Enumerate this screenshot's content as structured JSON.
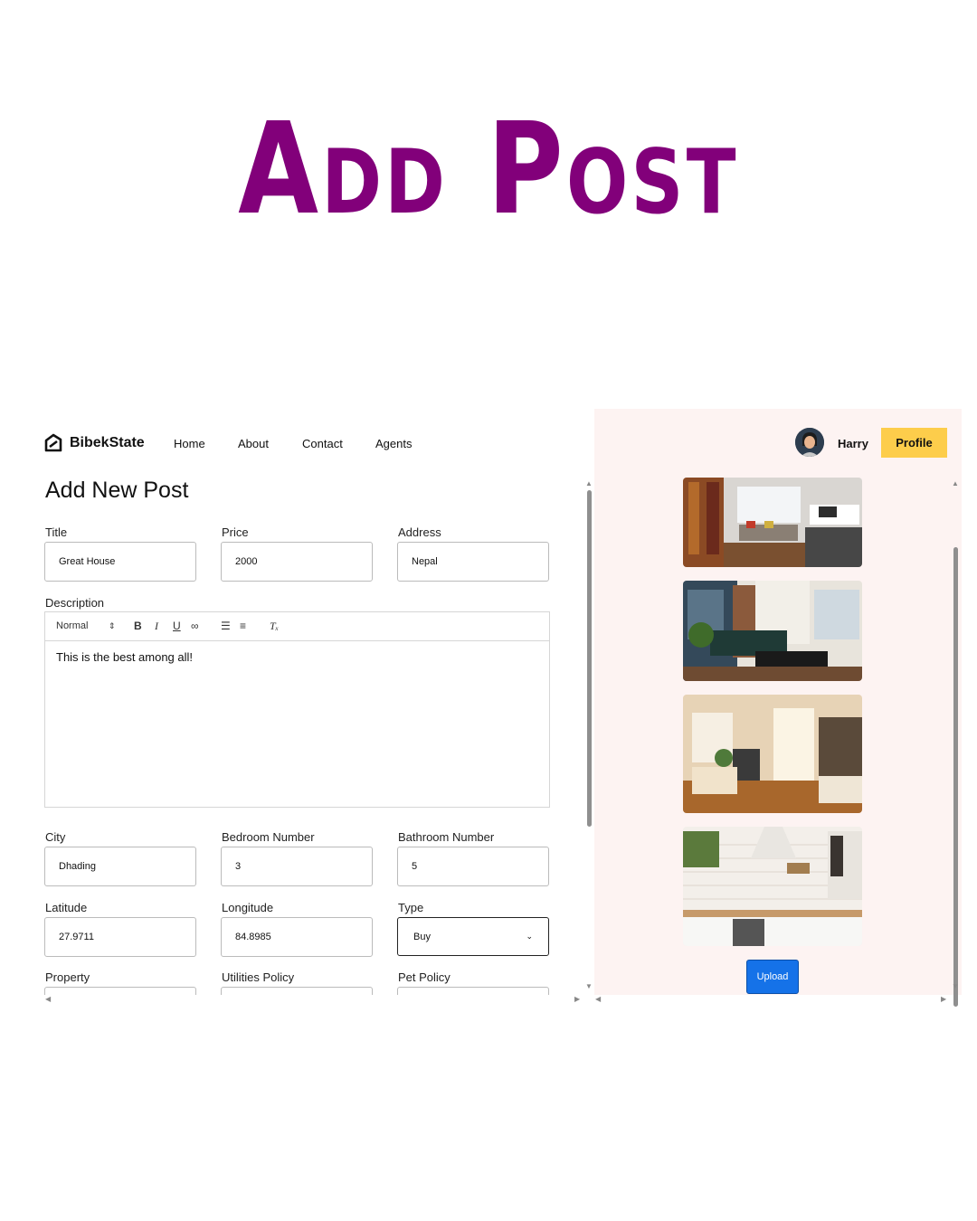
{
  "hero": {
    "title": "Add Post"
  },
  "nav": {
    "brand": "BibekState",
    "links": [
      "Home",
      "About",
      "Contact",
      "Agents"
    ]
  },
  "form": {
    "heading": "Add New Post",
    "title": {
      "label": "Title",
      "value": "Great House"
    },
    "price": {
      "label": "Price",
      "value": "2000"
    },
    "address": {
      "label": "Address",
      "value": "Nepal"
    },
    "description": {
      "label": "Description",
      "format": "Normal",
      "text": "This is the best among all!"
    },
    "city": {
      "label": "City",
      "value": "Dhading"
    },
    "bedroom": {
      "label": "Bedroom Number",
      "value": "3"
    },
    "bathroom": {
      "label": "Bathroom Number",
      "value": "5"
    },
    "latitude": {
      "label": "Latitude",
      "value": "27.9711"
    },
    "longitude": {
      "label": "Longitude",
      "value": "84.8985"
    },
    "type": {
      "label": "Type",
      "value": "Buy"
    },
    "property": {
      "label": "Property"
    },
    "utilities": {
      "label": "Utilities Policy"
    },
    "pet": {
      "label": "Pet Policy"
    }
  },
  "user": {
    "name": "Harry",
    "profile_label": "Profile"
  },
  "upload": {
    "label": "Upload"
  },
  "colors": {
    "hero": "#82007a",
    "profile": "#fdcd4b",
    "upload": "#1572e8",
    "panel": "#fdf3f2"
  }
}
